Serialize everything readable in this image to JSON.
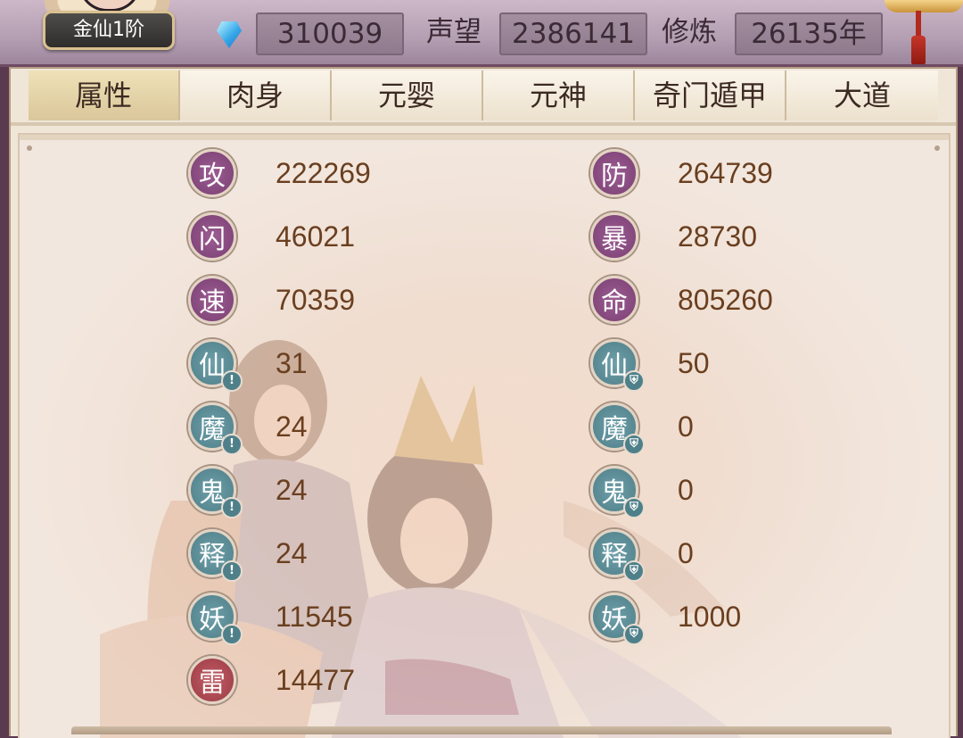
{
  "header": {
    "rank": "金仙1阶",
    "currency_value": "310039",
    "prestige_label": "声望",
    "prestige_value": "2386141",
    "cultivation_label": "修炼",
    "cultivation_value": "26135年"
  },
  "tabs": [
    "属性",
    "肉身",
    "元婴",
    "元神",
    "奇门遁甲",
    "大道"
  ],
  "active_tab": "属性",
  "stats_left": [
    {
      "glyph": "攻",
      "value": "222269",
      "color": "purple"
    },
    {
      "glyph": "闪",
      "value": "46021",
      "color": "purple"
    },
    {
      "glyph": "速",
      "value": "70359",
      "color": "purple"
    },
    {
      "glyph": "仙",
      "value": "31",
      "color": "teal",
      "badge": "!"
    },
    {
      "glyph": "魔",
      "value": "24",
      "color": "teal",
      "badge": "!"
    },
    {
      "glyph": "鬼",
      "value": "24",
      "color": "teal",
      "badge": "!"
    },
    {
      "glyph": "释",
      "value": "24",
      "color": "teal",
      "badge": "!"
    },
    {
      "glyph": "妖",
      "value": "11545",
      "color": "teal",
      "badge": "!"
    },
    {
      "glyph": "雷",
      "value": "14477",
      "color": "red"
    }
  ],
  "stats_right": [
    {
      "glyph": "防",
      "value": "264739",
      "color": "purple"
    },
    {
      "glyph": "暴",
      "value": "28730",
      "color": "purple"
    },
    {
      "glyph": "命",
      "value": "805260",
      "color": "purple"
    },
    {
      "glyph": "仙",
      "value": "50",
      "color": "teal",
      "badge": "shield"
    },
    {
      "glyph": "魔",
      "value": "0",
      "color": "teal",
      "badge": "shield"
    },
    {
      "glyph": "鬼",
      "value": "0",
      "color": "teal",
      "badge": "shield"
    },
    {
      "glyph": "释",
      "value": "0",
      "color": "teal",
      "badge": "shield"
    },
    {
      "glyph": "妖",
      "value": "1000",
      "color": "teal",
      "badge": "shield"
    }
  ],
  "icons": {
    "currency": "spirit-gem-icon",
    "attack_badge": "exclamation-icon",
    "defense_badge": "shield-icon"
  },
  "colors": {
    "purple": "#7a3f72",
    "teal": "#4e7f89",
    "red": "#9b3a44",
    "value_text": "#6a3f1f"
  }
}
